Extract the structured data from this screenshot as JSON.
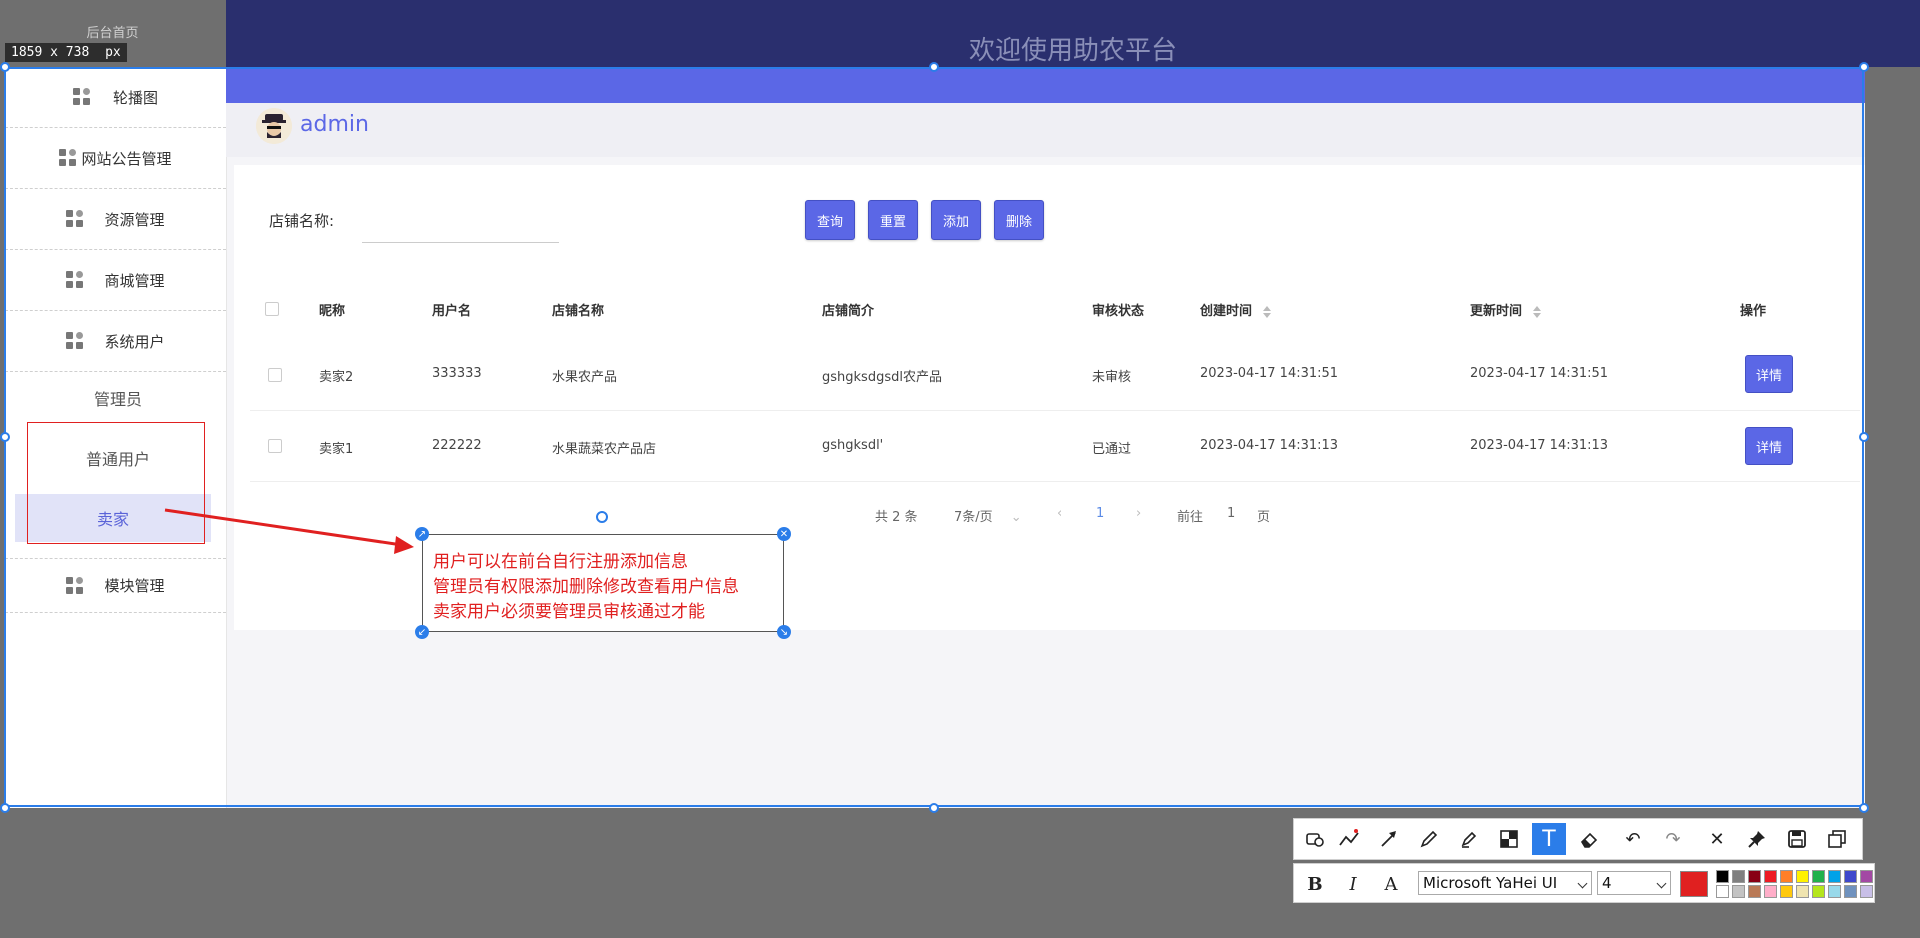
{
  "header": {
    "title": "欢迎使用助农平台",
    "top_link": "后台首页"
  },
  "capture": {
    "size_label": "1859 x 738",
    "unit": "px"
  },
  "sidebar": {
    "items": [
      {
        "label": "轮播图"
      },
      {
        "label": "网站公告管理"
      },
      {
        "label": "资源管理"
      },
      {
        "label": "商城管理"
      },
      {
        "label": "系统用户"
      }
    ],
    "sub_items": [
      {
        "label": "管理员"
      },
      {
        "label": "普通用户"
      },
      {
        "label": "卖家"
      }
    ],
    "module_item": "模块管理"
  },
  "user": {
    "name": "admin"
  },
  "search": {
    "label": "店铺名称:",
    "value": ""
  },
  "buttons": {
    "query": "查询",
    "reset": "重置",
    "add": "添加",
    "delete": "删除"
  },
  "table": {
    "headers": [
      "昵称",
      "用户名",
      "店铺名称",
      "店铺简介",
      "审核状态",
      "创建时间",
      "更新时间",
      "操作"
    ],
    "rows": [
      {
        "nickname": "卖家2",
        "username": "333333",
        "shop": "水果农产品",
        "intro": "gshgksdgsdl农产品",
        "status": "未审核",
        "created": "2023-04-17 14:31:51",
        "updated": "2023-04-17 14:31:51",
        "action": "详情"
      },
      {
        "nickname": "卖家1",
        "username": "222222",
        "shop": "水果蔬菜农产品店",
        "intro": "gshgksdl'",
        "status": "已通过",
        "created": "2023-04-17 14:31:13",
        "updated": "2023-04-17 14:31:13",
        "action": "详情"
      }
    ]
  },
  "pagination": {
    "total": "共 2 条",
    "page_size": "7条/页",
    "current": "1",
    "goto_label": "前往",
    "goto_value": "1",
    "page_suffix": "页"
  },
  "annotation": {
    "lines": [
      "用户可以在前台自行注册添加信息",
      "管理员有权限添加删除修改查看用户信息",
      "卖家用户必须要管理员审核通过才能"
    ],
    "color": "#e02020"
  },
  "toolbar": {
    "tools": [
      "shape-icon",
      "polyline-icon",
      "arrow-icon",
      "pen-icon",
      "marker-icon",
      "mosaic-icon",
      "text-icon",
      "eraser-icon",
      "undo-icon",
      "redo-icon",
      "close-icon",
      "pin-icon",
      "save-icon",
      "copy-icon"
    ],
    "font_name": "Microsoft YaHei UI",
    "font_size": "4",
    "current_color": "#e02020",
    "palette": [
      "#000000",
      "#7f7f7f",
      "#880015",
      "#ed1c24",
      "#ff7f27",
      "#fff200",
      "#22b14c",
      "#00a2e8",
      "#3f48cc",
      "#a349a4",
      "#ffffff",
      "#c3c3c3",
      "#b97a57",
      "#ffaec9",
      "#ffc90e",
      "#efe4b0",
      "#b5e61d",
      "#99d9ea",
      "#7092be",
      "#c8bfe7"
    ]
  }
}
